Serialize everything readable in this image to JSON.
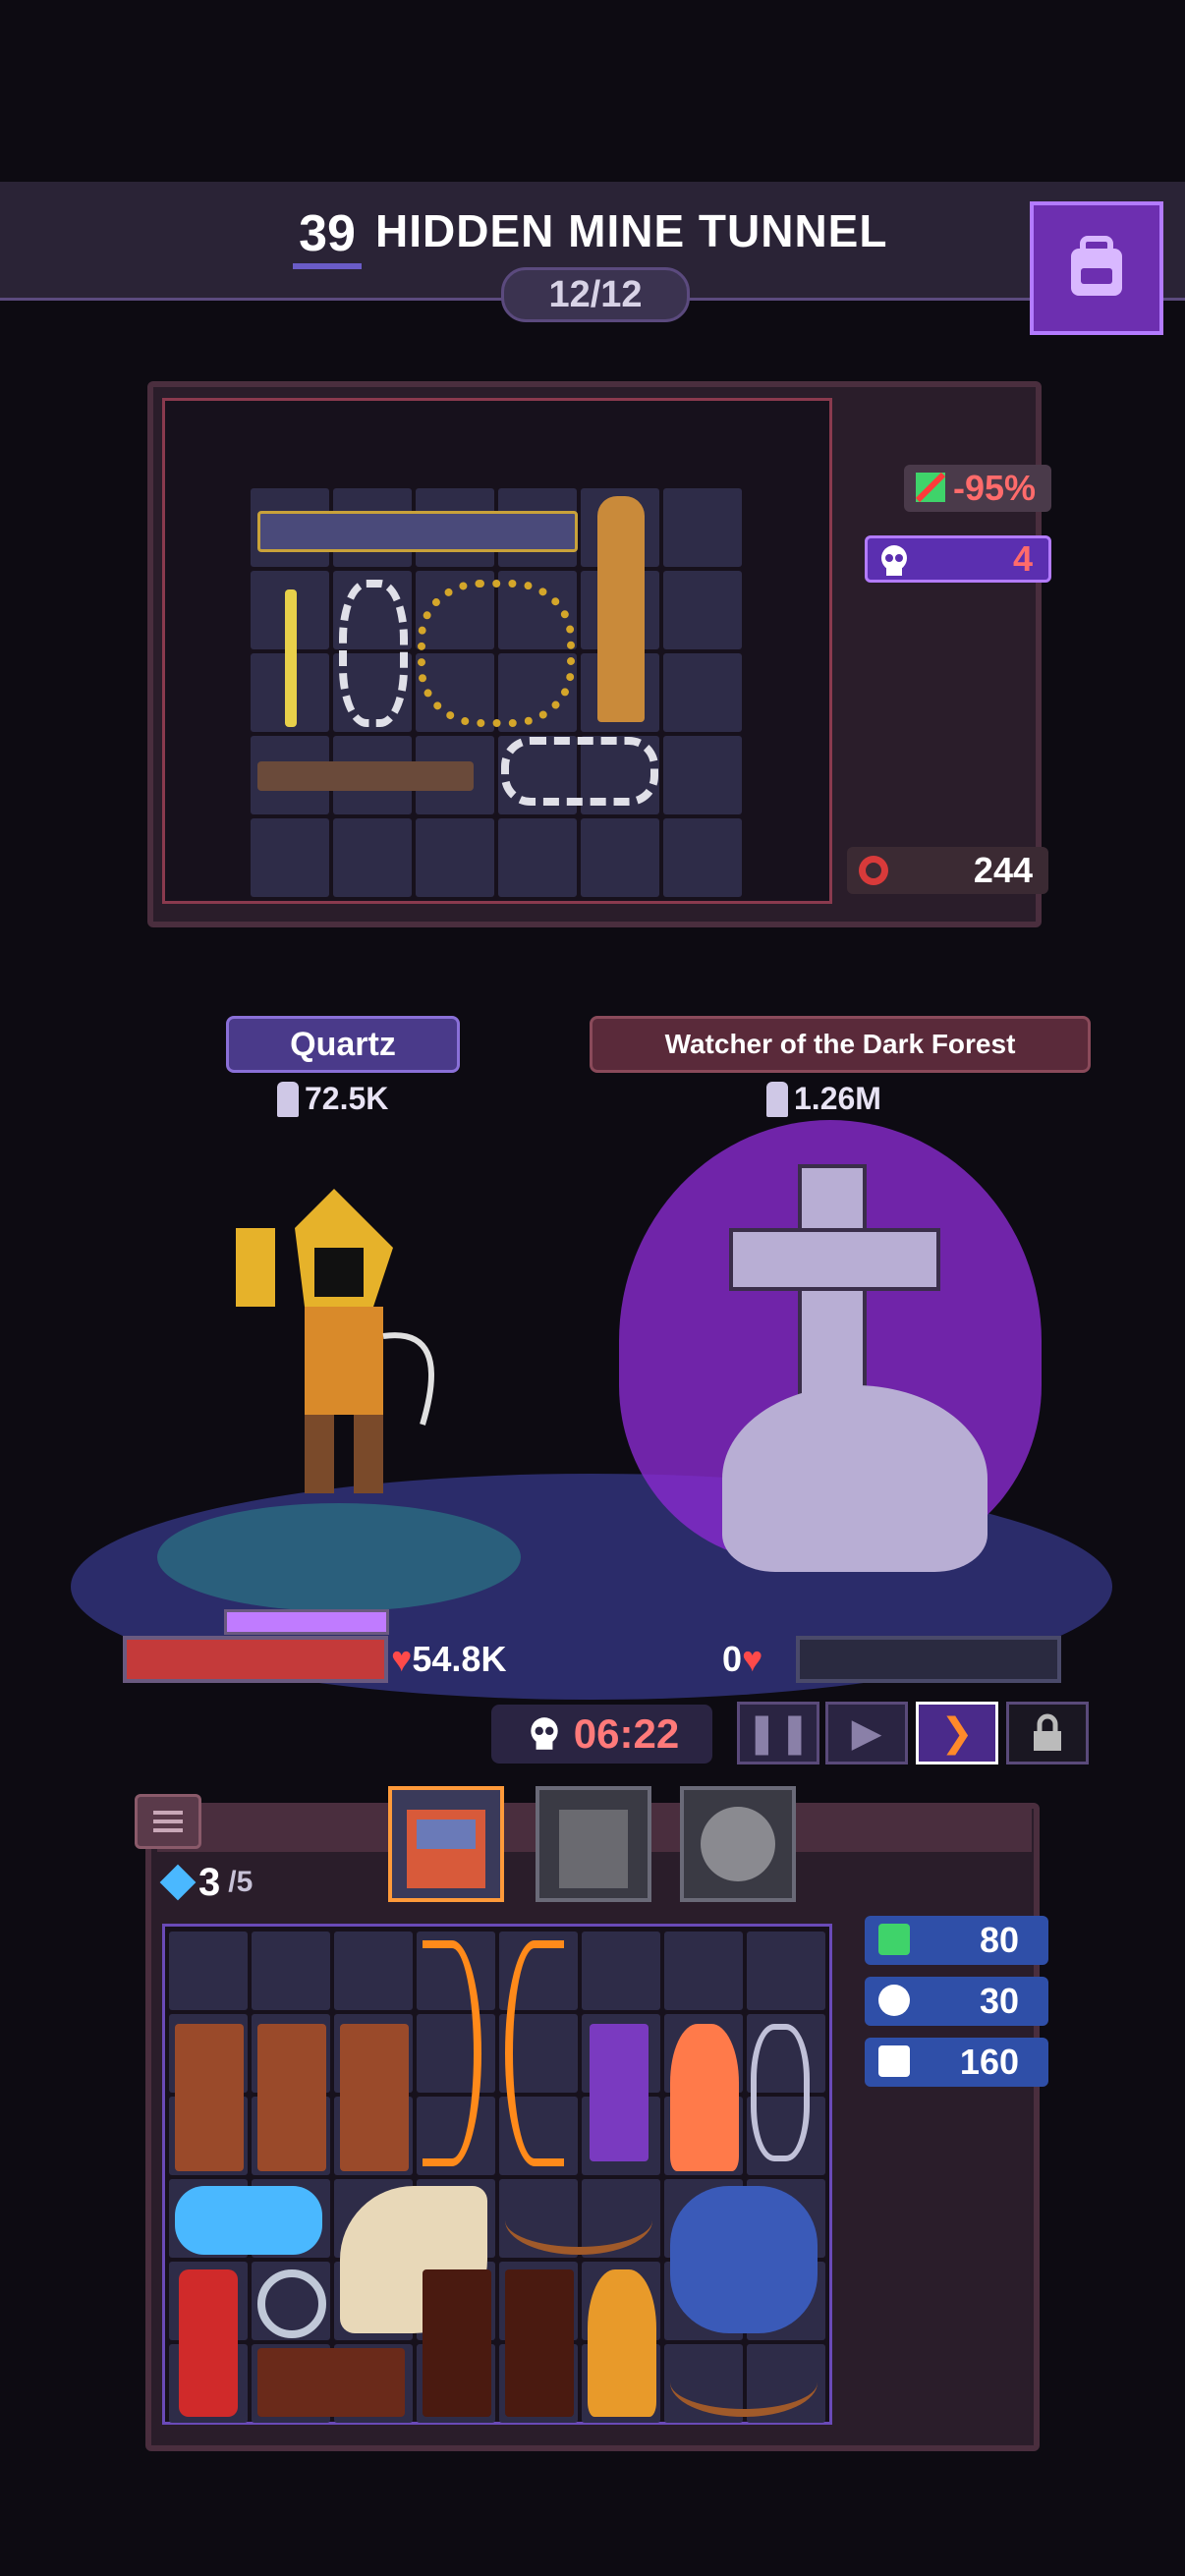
{
  "header": {
    "floor": "39",
    "zone_title": "HIDDEN MINE TUNNEL",
    "wave": "12/12"
  },
  "enemy_loot": {
    "damage_reduction": "-95%",
    "skull_count": "4",
    "health_regen": "244"
  },
  "player": {
    "name": "Quartz",
    "power": "72.5K",
    "hp": "54.8K"
  },
  "enemy": {
    "name": "Watcher of the Dark Forest",
    "power": "1.26M",
    "hp": "0"
  },
  "battle": {
    "timer": "06:22",
    "pause_label": "❚❚",
    "play_label": "▶",
    "fast_label": "❯",
    "lock_label": "🔒"
  },
  "inventory": {
    "gems": "3",
    "gems_max": "/5",
    "resources": [
      "80",
      "30",
      "160"
    ]
  },
  "icons": {
    "backpack": "backpack-icon",
    "skull": "skull-icon",
    "heart": "heart-icon",
    "sword": "sword-icon"
  },
  "colors": {
    "accent_purple": "#6d2fb0",
    "enemy_red": "#c43a3a",
    "resource_blue": "#2f4fa8"
  }
}
